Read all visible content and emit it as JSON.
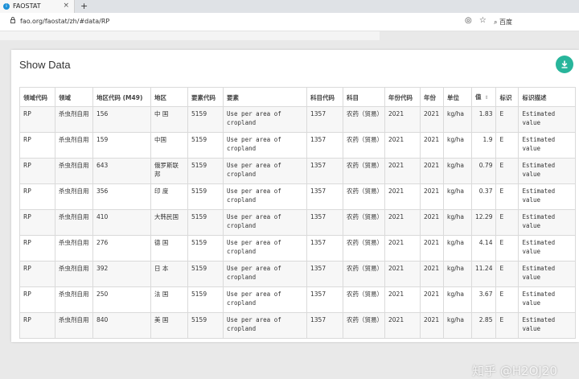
{
  "browser": {
    "tab_title": "FAOSTAT",
    "tab_favicon": "i",
    "url": "fao.org/faostat/zh/#data/RP",
    "search_label": "百度"
  },
  "page": {
    "title": "Show Data"
  },
  "table": {
    "headers": [
      "领域代码",
      "领域",
      "地区代码 (M49)",
      "地区",
      "要素代码",
      "要素",
      "科目代码",
      "科目",
      "年份代码",
      "年份",
      "单位",
      "值",
      "标识",
      "标识描述"
    ],
    "rows": [
      [
        "RP",
        "杀虫剂自用",
        "156",
        "中 国",
        "5159",
        "Use per area of cropland",
        "1357",
        "农药（贸易）",
        "2021",
        "2021",
        "kg/ha",
        "1.83",
        "E",
        "Estimated value"
      ],
      [
        "RP",
        "杀虫剂自用",
        "159",
        "中国",
        "5159",
        "Use per area of cropland",
        "1357",
        "农药（贸易）",
        "2021",
        "2021",
        "kg/ha",
        "1.9",
        "E",
        "Estimated value"
      ],
      [
        "RP",
        "杀虫剂自用",
        "643",
        "俄罗斯联邦",
        "5159",
        "Use per area of cropland",
        "1357",
        "农药（贸易）",
        "2021",
        "2021",
        "kg/ha",
        "0.79",
        "E",
        "Estimated value"
      ],
      [
        "RP",
        "杀虫剂自用",
        "356",
        "印 度",
        "5159",
        "Use per area of cropland",
        "1357",
        "农药（贸易）",
        "2021",
        "2021",
        "kg/ha",
        "0.37",
        "E",
        "Estimated value"
      ],
      [
        "RP",
        "杀虫剂自用",
        "410",
        "大韩民国",
        "5159",
        "Use per area of cropland",
        "1357",
        "农药（贸易）",
        "2021",
        "2021",
        "kg/ha",
        "12.29",
        "E",
        "Estimated value"
      ],
      [
        "RP",
        "杀虫剂自用",
        "276",
        "德 国",
        "5159",
        "Use per area of cropland",
        "1357",
        "农药（贸易）",
        "2021",
        "2021",
        "kg/ha",
        "4.14",
        "E",
        "Estimated value"
      ],
      [
        "RP",
        "杀虫剂自用",
        "392",
        "日 本",
        "5159",
        "Use per area of cropland",
        "1357",
        "农药（贸易）",
        "2021",
        "2021",
        "kg/ha",
        "11.24",
        "E",
        "Estimated value"
      ],
      [
        "RP",
        "杀虫剂自用",
        "250",
        "法 国",
        "5159",
        "Use per area of cropland",
        "1357",
        "农药（贸易）",
        "2021",
        "2021",
        "kg/ha",
        "3.67",
        "E",
        "Estimated value"
      ],
      [
        "RP",
        "杀虫剂自用",
        "840",
        "美 国",
        "5159",
        "Use per area of cropland",
        "1357",
        "农药（贸易）",
        "2021",
        "2021",
        "kg/ha",
        "2.85",
        "E",
        "Estimated value"
      ]
    ]
  },
  "watermark": "知乎 @H2OJ20",
  "colors": {
    "accent": "#28b59b"
  }
}
